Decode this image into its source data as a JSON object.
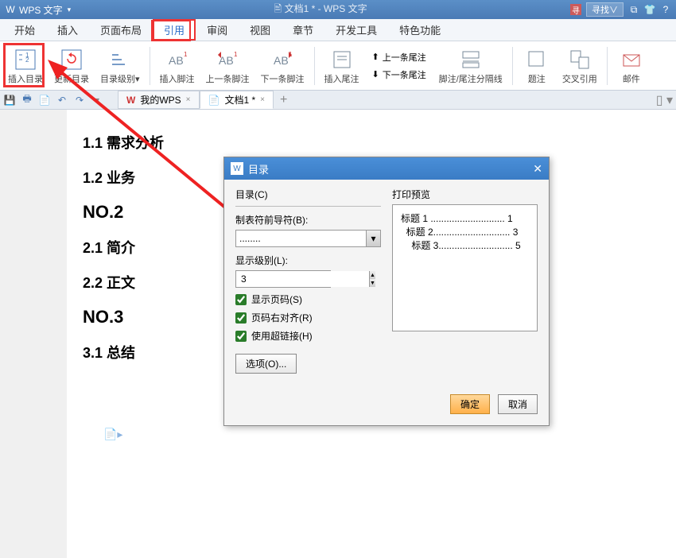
{
  "titlebar": {
    "app": "WPS 文字",
    "center": "🖹 文档1 * - WPS 文字",
    "search_placeholder": "寻找∨"
  },
  "menu": {
    "items": [
      "开始",
      "插入",
      "页面布局",
      "引用",
      "审阅",
      "视图",
      "章节",
      "开发工具",
      "特色功能"
    ],
    "active_index": 3
  },
  "ribbon": {
    "insert_toc": "插入目录",
    "update_toc": "更新目录",
    "toc_level": "目录级别",
    "insert_footnote": "插入脚注",
    "prev_footnote": "上一条脚注",
    "next_footnote": "下一条脚注",
    "insert_endnote": "插入尾注",
    "prev_endnote": "上一条尾注",
    "next_endnote": "下一条尾注",
    "footnote_sep": "脚注/尾注分隔线",
    "caption": "题注",
    "cross_ref": "交叉引用",
    "mail": "邮件"
  },
  "tabs": {
    "wps": "我的WPS",
    "doc": "文档1 *"
  },
  "document": {
    "h11": "1.1 需求分析",
    "h12": "1.2 业务",
    "no2": "NO.2",
    "h21": "2.1 简介",
    "h22": "2.2 正文",
    "no3": "NO.3",
    "h31": "3.1 总结"
  },
  "dialog": {
    "title": "目录",
    "fieldset": "目录(C)",
    "tab_leader_label": "制表符前导符(B):",
    "tab_leader_value": "........",
    "display_level_label": "显示级别(L):",
    "display_level_value": "3",
    "show_page_num": "显示页码(S)",
    "align_right": "页码右对齐(R)",
    "use_hyperlink": "使用超链接(H)",
    "options_btn": "选项(O)...",
    "preview_label": "打印预览",
    "preview_lines": [
      "标题 1 ............................ 1",
      "  标题 2............................. 3",
      "    标题 3............................ 5"
    ],
    "ok": "确定",
    "cancel": "取消"
  }
}
